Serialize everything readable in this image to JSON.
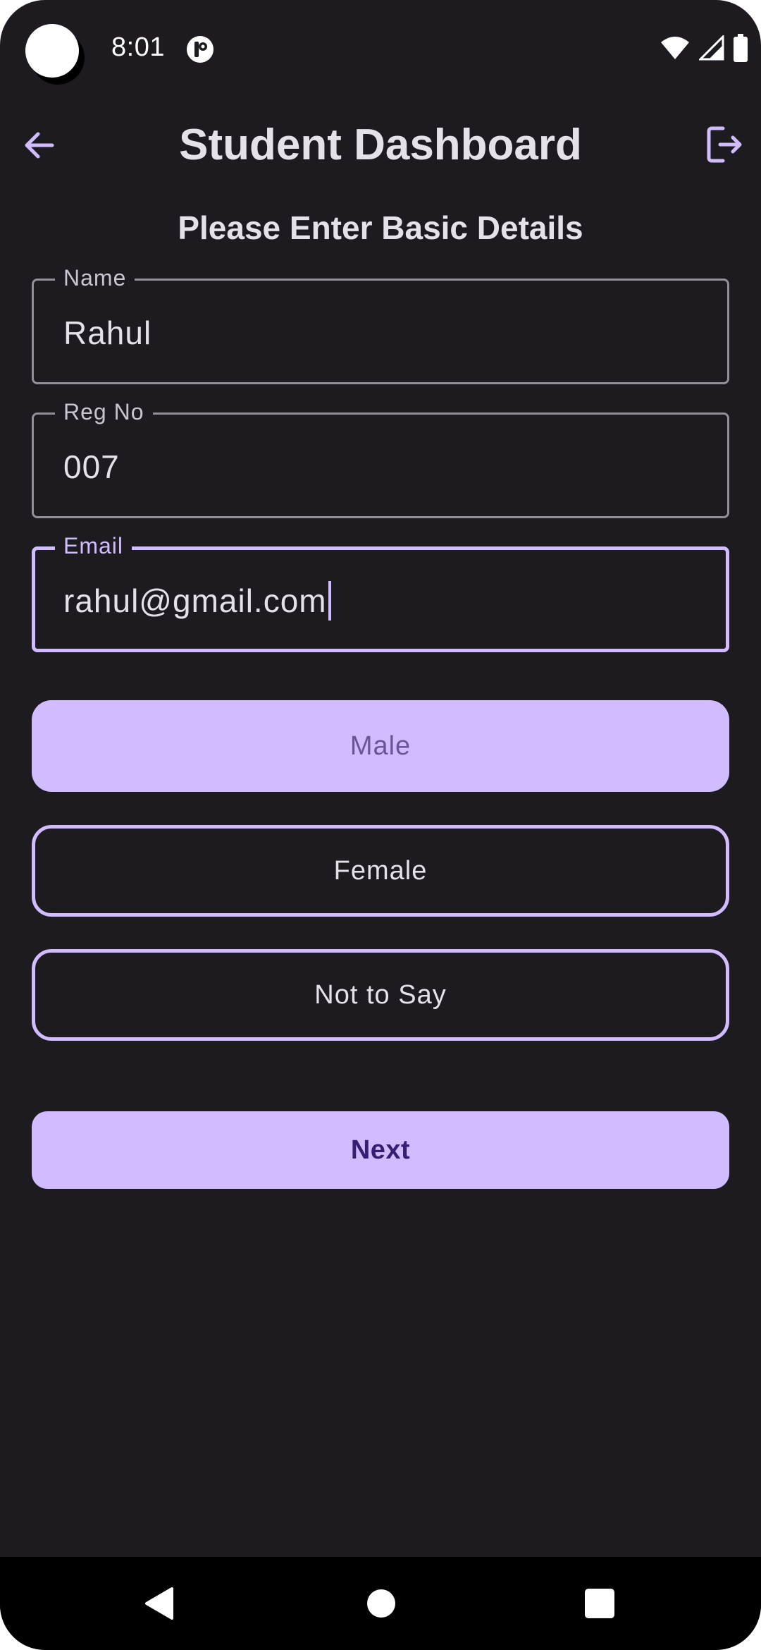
{
  "status_bar": {
    "time": "8:01",
    "icons": [
      "camera-cutout-icon",
      "app-notification-icon",
      "wifi-icon",
      "signal-icon",
      "battery-icon"
    ]
  },
  "app_bar": {
    "title": "Student Dashboard",
    "back_icon": "arrow-back-icon",
    "logout_icon": "logout-icon"
  },
  "form": {
    "heading": "Please Enter Basic Details",
    "fields": [
      {
        "label": "Name",
        "value": "Rahul"
      },
      {
        "label": "Reg No",
        "value": "007"
      },
      {
        "label": "Email",
        "value": "rahul@gmail.com",
        "focused": true
      }
    ],
    "gender_options": [
      {
        "label": "Male",
        "selected": true
      },
      {
        "label": "Female",
        "selected": false
      },
      {
        "label": "Not to Say",
        "selected": false
      }
    ],
    "next_label": "Next"
  },
  "nav_bar": {
    "icons": [
      "nav-back-icon",
      "nav-home-icon",
      "nav-recents-icon"
    ]
  },
  "colors": {
    "background": "#1d1b20",
    "primary": "#d0bcff",
    "on_primary": "#381e72",
    "outline": "#938f99",
    "text": "#e6e0e9"
  }
}
